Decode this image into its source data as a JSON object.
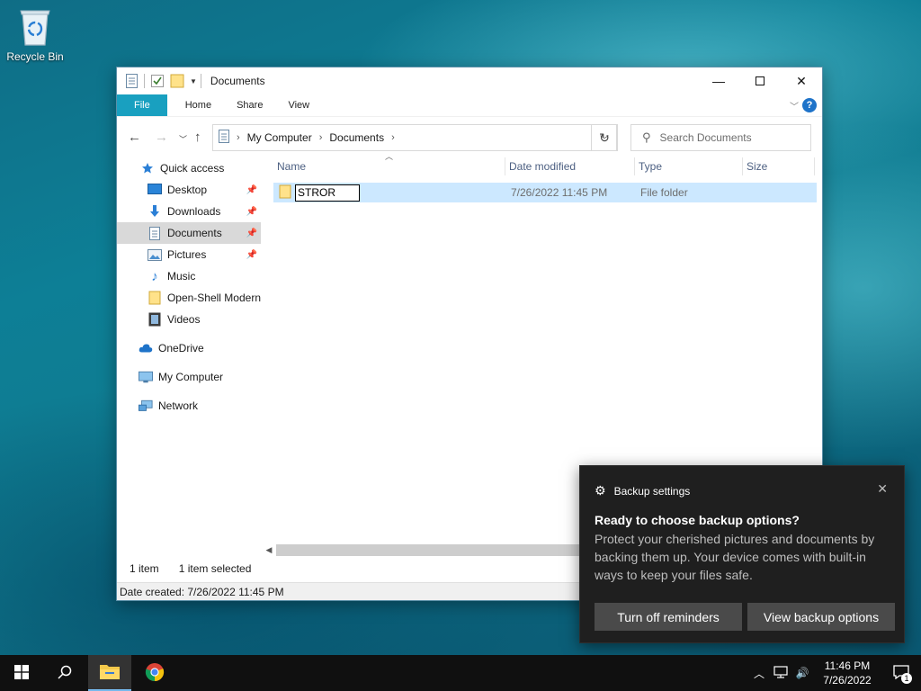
{
  "desktop": {
    "recycle_bin_label": "Recycle Bin"
  },
  "explorer": {
    "window_title": "Documents",
    "ribbon_tabs": [
      "File",
      "Home",
      "Share",
      "View"
    ],
    "address": {
      "crumbs": [
        "My Computer",
        "Documents"
      ]
    },
    "search_placeholder": "Search Documents",
    "nav_pane": {
      "quick_access": "Quick access",
      "items": [
        "Desktop",
        "Downloads",
        "Documents",
        "Pictures",
        "Music",
        "Open-Shell Modern",
        "Videos"
      ],
      "onedrive": "OneDrive",
      "my_computer": "My Computer",
      "network": "Network"
    },
    "columns": [
      "Name",
      "Date modified",
      "Type",
      "Size"
    ],
    "rows": [
      {
        "name_edit_value": "STROR",
        "date_modified": "7/26/2022 11:45 PM",
        "type": "File folder",
        "size": ""
      }
    ],
    "status": {
      "item_count": "1 item",
      "selected": "1 item selected"
    },
    "details": "Date created: 7/26/2022 11:45 PM"
  },
  "toast": {
    "app_name": "Backup settings",
    "title": "Ready to choose backup options?",
    "body": "Protect your cherished pictures and documents by backing them up. Your device comes with built-in ways to keep your files safe.",
    "button_primary": "Turn off reminders",
    "button_secondary": "View backup options"
  },
  "taskbar": {
    "time": "11:46 PM",
    "date": "7/26/2022",
    "notification_count": "1"
  },
  "colors": {
    "accent_file_tab": "#19a0c0",
    "selection": "#cce8ff",
    "toast_bg": "#1f1f1f",
    "taskbar_bg": "#101010"
  }
}
